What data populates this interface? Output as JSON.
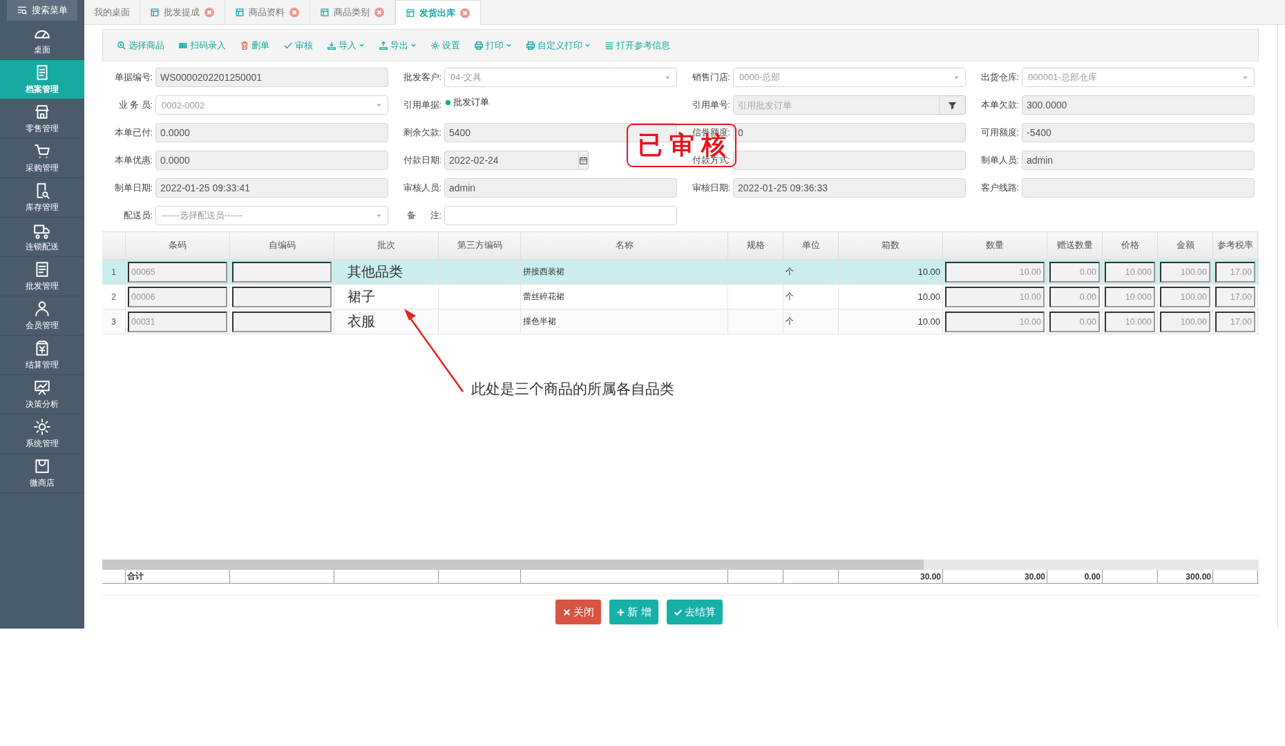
{
  "sidebar": {
    "search": "搜索菜单",
    "items": [
      {
        "label": "桌面",
        "selected": false
      },
      {
        "label": "档案管理",
        "selected": true
      },
      {
        "label": "零售管理",
        "selected": false
      },
      {
        "label": "采购管理",
        "selected": false
      },
      {
        "label": "库存管理",
        "selected": false
      },
      {
        "label": "连锁配送",
        "selected": false
      },
      {
        "label": "批发管理",
        "selected": false
      },
      {
        "label": "会员管理",
        "selected": false
      },
      {
        "label": "结算管理",
        "selected": false
      },
      {
        "label": "决策分析",
        "selected": false
      },
      {
        "label": "系统管理",
        "selected": false
      },
      {
        "label": "微商店",
        "selected": false
      }
    ]
  },
  "tabs": [
    {
      "label": "我的桌面",
      "closable": false,
      "selected": false
    },
    {
      "label": "批发提成",
      "closable": true,
      "selected": false
    },
    {
      "label": "商品资料",
      "closable": true,
      "selected": false
    },
    {
      "label": "商品类别",
      "closable": true,
      "selected": false
    },
    {
      "label": "发货出库",
      "closable": true,
      "selected": true
    }
  ],
  "toolbar": [
    {
      "label": "选择商品",
      "dropdown": false
    },
    {
      "label": "扫码录入",
      "dropdown": false
    },
    {
      "label": "删单",
      "dropdown": false
    },
    {
      "label": "审核",
      "dropdown": false
    },
    {
      "label": "导入",
      "dropdown": true
    },
    {
      "label": "导出",
      "dropdown": true
    },
    {
      "label": "设置",
      "dropdown": false
    },
    {
      "label": "打印",
      "dropdown": true
    },
    {
      "label": "自定义打印",
      "dropdown": true
    },
    {
      "label": "打开参考信息",
      "dropdown": false
    }
  ],
  "form": [
    [
      {
        "label": "单据编号:",
        "kind": "text",
        "readonly": true,
        "value": "WS0000202201250001"
      },
      {
        "label": "批发客户:",
        "kind": "select",
        "value": "04-文具"
      },
      {
        "label": "销售门店:",
        "kind": "select",
        "value": "0000-总部"
      },
      {
        "label": "出货仓库:",
        "kind": "select",
        "value": "000001-总部仓库"
      }
    ],
    [
      {
        "label": "业 务 员:",
        "kind": "select",
        "value": "0002-0002"
      },
      {
        "label": "引用单据:",
        "kind": "radio",
        "options": [
          {
            "label": "批发订单",
            "selected": true
          }
        ]
      },
      {
        "label": "引用单号:",
        "kind": "lookup",
        "placeholder": "引用批发订单"
      },
      {
        "label": "本单欠款:",
        "kind": "text",
        "readonly": true,
        "value": "300.0000"
      }
    ],
    [
      {
        "label": "本单已付:",
        "kind": "text",
        "readonly": true,
        "value": "0.0000"
      },
      {
        "label": "剩余欠款:",
        "kind": "text",
        "readonly": true,
        "value": "5400"
      },
      {
        "label": "信誉额度:",
        "kind": "text",
        "readonly": true,
        "value": "0"
      },
      {
        "label": "可用额度:",
        "kind": "text",
        "readonly": true,
        "value": "-5400"
      }
    ],
    [
      {
        "label": "本单优惠:",
        "kind": "text",
        "readonly": true,
        "value": "0.0000"
      },
      {
        "label": "付款日期:",
        "kind": "date",
        "value": "2022-02-24"
      },
      {
        "label": "付款方式:",
        "kind": "text",
        "readonly": true
      },
      {
        "label": "制单人员:",
        "kind": "text",
        "readonly": true,
        "value": "admin"
      }
    ],
    [
      {
        "label": "制单日期:",
        "kind": "text",
        "readonly": true,
        "value": "2022-01-25 09:33:41"
      },
      {
        "label": "审核人员:",
        "kind": "text",
        "readonly": true,
        "value": "admin"
      },
      {
        "label": "审核日期:",
        "kind": "text",
        "readonly": true,
        "value": "2022-01-25 09:36:33"
      },
      {
        "label": "客户线路:",
        "kind": "text",
        "readonly": true
      }
    ],
    [
      {
        "label": "配送员:",
        "kind": "select",
        "placeholder": "------选择配送员------"
      },
      {
        "label": "备      注:",
        "kind": "text",
        "readonly": false
      }
    ]
  ],
  "stamp": "已审核",
  "table": {
    "columns": [
      {
        "title": "条码",
        "total": "合计"
      },
      {
        "title": "自编码"
      },
      {
        "title": "批次"
      },
      {
        "title": "第三方编码"
      },
      {
        "title": "名称"
      },
      {
        "title": "规格"
      },
      {
        "title": "单位"
      },
      {
        "title": "箱数",
        "total": "30.00"
      },
      {
        "title": "数量",
        "total": "30.00"
      },
      {
        "title": "赠送数量",
        "total": "0.00"
      },
      {
        "title": "价格"
      },
      {
        "title": "金额",
        "total": "300.00"
      },
      {
        "title": "参考税率"
      }
    ],
    "rows": [
      {
        "no": "1",
        "selected": true,
        "barcode": "00065",
        "batch": "其他品类",
        "name": "拼接西装裙",
        "unit": "个",
        "boxes": "10.00",
        "qty": "10.00",
        "gift_qty": "0.00",
        "price": "10.000",
        "amount": "100.00",
        "tax_rate": "17.00"
      },
      {
        "no": "2",
        "selected": false,
        "barcode": "00006",
        "batch": "裙子",
        "name": "蕾丝碎花裙",
        "unit": "个",
        "boxes": "10.00",
        "qty": "10.00",
        "gift_qty": "0.00",
        "price": "10.000",
        "amount": "100.00",
        "tax_rate": "17.00"
      },
      {
        "no": "3",
        "selected": false,
        "barcode": "00031",
        "batch": "衣服",
        "name": "撞色半裙",
        "unit": "个",
        "boxes": "10.00",
        "qty": "10.00",
        "gift_qty": "0.00",
        "price": "10.000",
        "amount": "100.00",
        "tax_rate": "17.00"
      }
    ]
  },
  "annotation": "此处是三个商品的所属各自品类",
  "buttons": [
    {
      "label": "关闭",
      "kind": "danger"
    },
    {
      "label": "新 增",
      "kind": "primary"
    },
    {
      "label": "去结算",
      "kind": "primary"
    }
  ]
}
